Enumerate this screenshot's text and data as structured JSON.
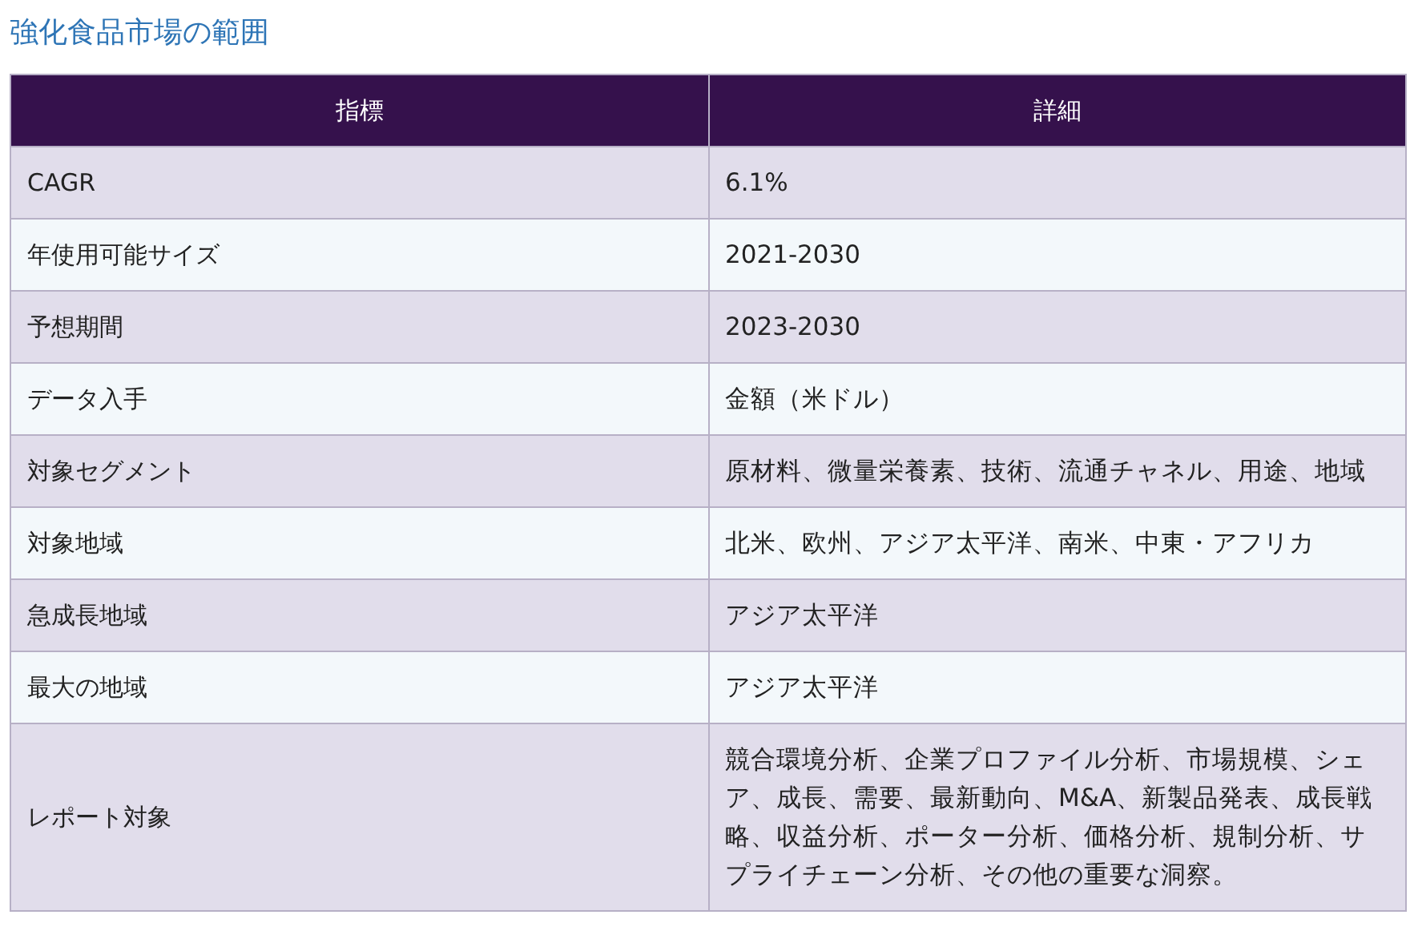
{
  "title": "強化食品市場の範囲",
  "table": {
    "columns": [
      "指標",
      "詳細"
    ],
    "rows": [
      [
        "CAGR",
        "6.1%"
      ],
      [
        "年使用可能サイズ",
        "2021-2030"
      ],
      [
        "予想期間",
        "2023-2030"
      ],
      [
        "データ入手",
        "金額（米ドル）"
      ],
      [
        "対象セグメント",
        "原材料、微量栄養素、技術、流通チャネル、用途、地域"
      ],
      [
        "対象地域",
        "北米、欧州、アジア太平洋、南米、中東・アフリカ"
      ],
      [
        "急成長地域",
        "アジア太平洋"
      ],
      [
        "最大の地域",
        "アジア太平洋"
      ],
      [
        "レポート対象",
        "競合環境分析、企業プロファイル分析、市場規模、シェア、成長、需要、最新動向、M&A、新製品発表、成長戦略、収益分析、ポーター分析、価格分析、規制分析、サプライチェーン分析、その他の重要な洞察。"
      ]
    ]
  }
}
